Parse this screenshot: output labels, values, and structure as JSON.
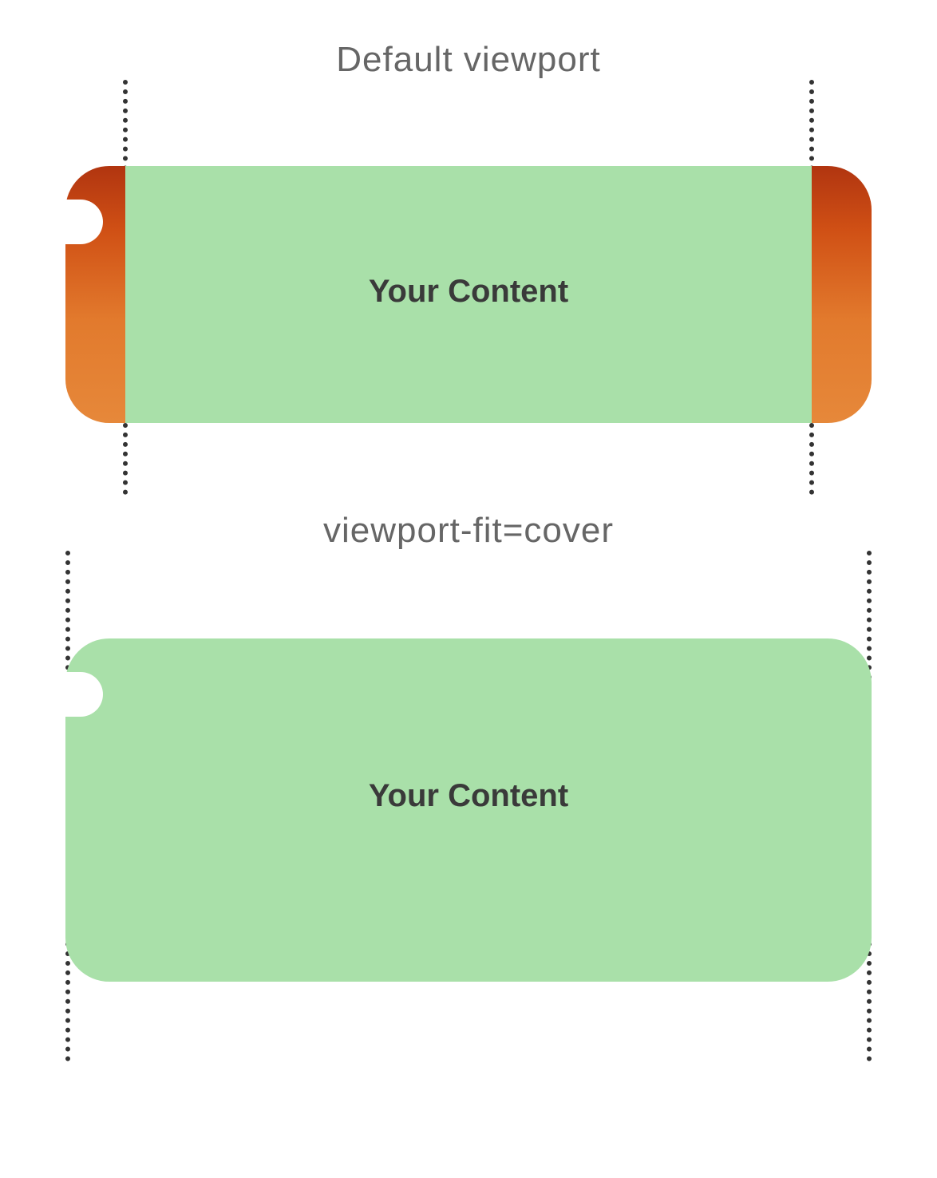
{
  "section1": {
    "title": "Default viewport",
    "content_label": "Your Content"
  },
  "section2": {
    "title": "viewport-fit=cover",
    "content_label": "Your Content"
  },
  "colors": {
    "content_bg": "#a9e0a9",
    "pillarbox_gradient_top": "#b13510",
    "pillarbox_gradient_bottom": "#e6883a",
    "text_dark": "#3a3a3a",
    "title_gray": "#666666"
  }
}
